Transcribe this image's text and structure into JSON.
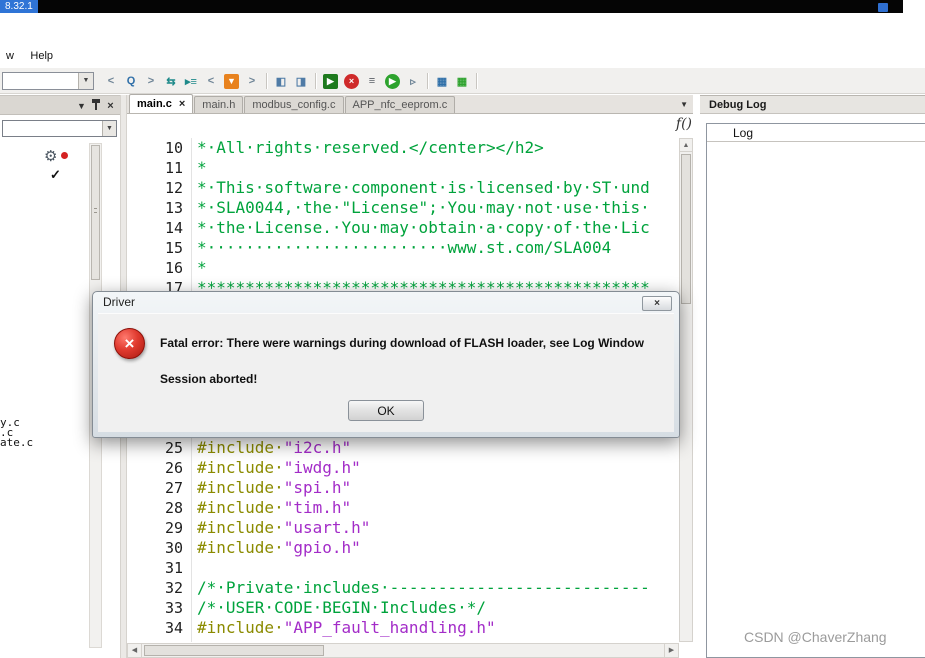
{
  "titlebar": {
    "version": "8.32.1"
  },
  "menubar": {
    "partial": "w",
    "help": "Help"
  },
  "toolbar": {
    "icons": [
      {
        "name": "nav-back-icon",
        "glyph": "<",
        "fg": "#6e8496"
      },
      {
        "name": "search-icon",
        "glyph": "Q",
        "fg": "#2f6fa8"
      },
      {
        "name": "nav-forward-icon",
        "glyph": ">",
        "fg": "#6e8496"
      },
      {
        "name": "toggle-source-icon",
        "glyph": "⇆",
        "fg": "#1f8a8a"
      },
      {
        "name": "trace-icon",
        "glyph": "▸≡",
        "fg": "#1f8a8a"
      },
      {
        "name": "prev-bookmark-icon",
        "glyph": "<",
        "fg": "#6e8496"
      },
      {
        "name": "bookmark-icon",
        "glyph": "▼",
        "fg": "#ffffff",
        "bg": "#e8821e"
      },
      {
        "name": "next-bookmark-icon",
        "glyph": ">",
        "fg": "#6e8496"
      },
      {
        "sep": true
      },
      {
        "name": "prev-doc-icon",
        "glyph": "◧",
        "fg": "#4f7ba6"
      },
      {
        "name": "next-doc-icon",
        "glyph": "◨",
        "fg": "#4f7ba6"
      },
      {
        "sep": true
      },
      {
        "name": "download-debug-icon",
        "glyph": "▶",
        "fg": "#ffffff",
        "bg": "#1e7a1e"
      },
      {
        "name": "stop-debug-icon",
        "glyph": "×",
        "fg": "#ffffff",
        "bg": "#cf2a2a",
        "round": true
      },
      {
        "name": "make-icon",
        "glyph": "≡",
        "fg": "#5a5f66"
      },
      {
        "name": "go-icon",
        "glyph": "▶",
        "fg": "#ffffff",
        "bg": "#2ea32e",
        "round": true
      },
      {
        "name": "step-icon",
        "glyph": "▹",
        "fg": "#6e8496"
      },
      {
        "sep": true
      },
      {
        "name": "board-config-icon",
        "glyph": "▦",
        "fg": "#2f6fa8"
      },
      {
        "name": "board-status-icon",
        "glyph": "▦",
        "fg": "#2ea32e"
      },
      {
        "sep": true
      }
    ]
  },
  "workspace": {
    "partial_files": [
      "y.c",
      ".c",
      "ate.c"
    ]
  },
  "editor": {
    "tabs": [
      {
        "label": "main.c",
        "active": true
      },
      {
        "label": "main.h"
      },
      {
        "label": "modbus_config.c"
      },
      {
        "label": "APP_nfc_eeprom.c"
      }
    ],
    "close_glyph": "×",
    "fn_badge": "f()",
    "lines": [
      {
        "n": "10",
        "parts": [
          {
            "c": "com",
            "t": "*·All·rights·reserved.</center></h2>"
          }
        ]
      },
      {
        "n": "11",
        "parts": [
          {
            "c": "com",
            "t": "*"
          }
        ]
      },
      {
        "n": "12",
        "parts": [
          {
            "c": "com",
            "t": "*·This·software·component·is·licensed·by·ST·und"
          }
        ]
      },
      {
        "n": "13",
        "parts": [
          {
            "c": "com",
            "t": "*·SLA0044,·the·\"License\";·You·may·not·use·this·"
          }
        ]
      },
      {
        "n": "14",
        "parts": [
          {
            "c": "com",
            "t": "*·the·License.·You·may·obtain·a·copy·of·the·Lic"
          }
        ]
      },
      {
        "n": "15",
        "parts": [
          {
            "c": "com",
            "t": "*·························www.st.com/SLA004"
          }
        ]
      },
      {
        "n": "16",
        "parts": [
          {
            "c": "com",
            "t": "*"
          }
        ]
      },
      {
        "n": "17",
        "parts": [
          {
            "c": "com",
            "t": "***********************************************"
          }
        ]
      },
      {
        "n": "",
        "parts": []
      },
      {
        "n": "",
        "parts": []
      },
      {
        "n": "",
        "parts": []
      },
      {
        "n": "",
        "parts": []
      },
      {
        "n": "",
        "parts": []
      },
      {
        "n": "",
        "parts": []
      },
      {
        "n": "",
        "parts": []
      },
      {
        "n": "25",
        "parts": [
          {
            "c": "dir",
            "t": "#include·"
          },
          {
            "c": "str",
            "t": "\"i2c.h\""
          }
        ]
      },
      {
        "n": "26",
        "parts": [
          {
            "c": "dir",
            "t": "#include·"
          },
          {
            "c": "str",
            "t": "\"iwdg.h\""
          }
        ]
      },
      {
        "n": "27",
        "parts": [
          {
            "c": "dir",
            "t": "#include·"
          },
          {
            "c": "str",
            "t": "\"spi.h\""
          }
        ]
      },
      {
        "n": "28",
        "parts": [
          {
            "c": "dir",
            "t": "#include·"
          },
          {
            "c": "str",
            "t": "\"tim.h\""
          }
        ]
      },
      {
        "n": "29",
        "parts": [
          {
            "c": "dir",
            "t": "#include·"
          },
          {
            "c": "str",
            "t": "\"usart.h\""
          }
        ]
      },
      {
        "n": "30",
        "parts": [
          {
            "c": "dir",
            "t": "#include·"
          },
          {
            "c": "str",
            "t": "\"gpio.h\""
          }
        ]
      },
      {
        "n": "31",
        "parts": []
      },
      {
        "n": "32",
        "parts": [
          {
            "c": "com",
            "t": "/*·Private·includes·---------------------------"
          }
        ]
      },
      {
        "n": "33",
        "parts": [
          {
            "c": "com",
            "t": "/*·USER·CODE·BEGIN·Includes·*/"
          }
        ]
      },
      {
        "n": "34",
        "parts": [
          {
            "c": "dir",
            "t": "#include·"
          },
          {
            "c": "str",
            "t": "\"APP_fault_handling.h\""
          }
        ]
      }
    ]
  },
  "debug_log": {
    "title": "Debug Log",
    "column_header": "Log"
  },
  "dialog": {
    "title": "Driver",
    "close_glyph": "×",
    "icon_glyph": "×",
    "line1": "Fatal error: There were warnings during download of FLASH loader, see Log Window",
    "line2": "Session aborted!",
    "ok": "OK"
  },
  "watermark": "CSDN @ChaverZhang",
  "colors": {
    "comment": "#00A33C",
    "directive": "#8B8B00",
    "string": "#A32CC8",
    "linenum": "#1e1e1e"
  }
}
